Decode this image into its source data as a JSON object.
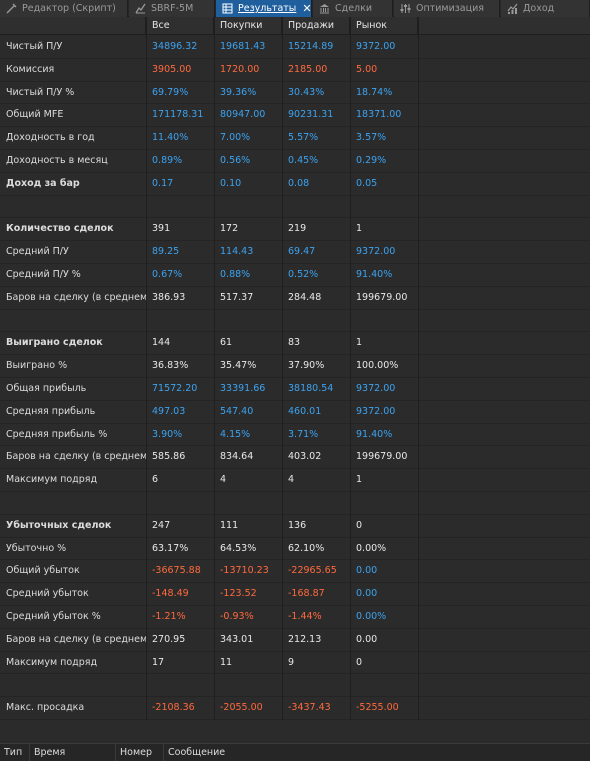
{
  "tabs": [
    {
      "label": "Редактор (Скрипт)",
      "icon": "code-icon",
      "active": false
    },
    {
      "label": "SBRF-5M",
      "icon": "chart-icon",
      "active": false
    },
    {
      "label": "Результаты",
      "icon": "table-icon",
      "active": true
    },
    {
      "label": "Сделки",
      "icon": "bank-icon",
      "active": false
    },
    {
      "label": "Оптимизация",
      "icon": "optimization-icon",
      "active": false
    },
    {
      "label": "Доход",
      "icon": "income-chart-icon",
      "active": false
    }
  ],
  "table": {
    "columns": [
      "",
      "Все",
      "Покупки",
      "Продажи",
      "Рынок"
    ],
    "rows": [
      {
        "label": "Чистый П/У",
        "values": [
          "34896.32",
          "19681.43",
          "15214.89",
          "9372.00"
        ],
        "tone": "blue",
        "bold": false
      },
      {
        "label": "Комиссия",
        "values": [
          "3905.00",
          "1720.00",
          "2185.00",
          "5.00"
        ],
        "tone": "red",
        "bold": false
      },
      {
        "label": "Чистый П/У %",
        "values": [
          "69.79%",
          "39.36%",
          "30.43%",
          "18.74%"
        ],
        "tone": "blue",
        "bold": false
      },
      {
        "label": "Общий MFE",
        "values": [
          "171178.31",
          "80947.00",
          "90231.31",
          "18371.00"
        ],
        "tone": "blue",
        "bold": false
      },
      {
        "label": "Доходность в год",
        "values": [
          "11.40%",
          "7.00%",
          "5.57%",
          "3.57%"
        ],
        "tone": "blue",
        "bold": false
      },
      {
        "label": "Доходность в месяц",
        "values": [
          "0.89%",
          "0.56%",
          "0.45%",
          "0.29%"
        ],
        "tone": "blue",
        "bold": false
      },
      {
        "label": "Доход за бар",
        "values": [
          "0.17",
          "0.10",
          "0.08",
          "0.05"
        ],
        "tone": "blue",
        "bold": true
      },
      {
        "label": "",
        "values": [
          "",
          "",
          "",
          ""
        ],
        "tone": "white",
        "bold": false
      },
      {
        "label": "Количество сделок",
        "values": [
          "391",
          "172",
          "219",
          "1"
        ],
        "tone": "white",
        "bold": true
      },
      {
        "label": "Средний П/У",
        "values": [
          "89.25",
          "114.43",
          "69.47",
          "9372.00"
        ],
        "tone": "blue",
        "bold": false
      },
      {
        "label": "Средний П/У %",
        "values": [
          "0.67%",
          "0.88%",
          "0.52%",
          "91.40%"
        ],
        "tone": "blue",
        "bold": false
      },
      {
        "label": "Баров на сделку (в среднем)",
        "values": [
          "386.93",
          "517.37",
          "284.48",
          "199679.00"
        ],
        "tone": "white",
        "bold": false
      },
      {
        "label": "",
        "values": [
          "",
          "",
          "",
          ""
        ],
        "tone": "white",
        "bold": false
      },
      {
        "label": "Выиграно сделок",
        "values": [
          "144",
          "61",
          "83",
          "1"
        ],
        "tone": "white",
        "bold": true
      },
      {
        "label": "Выиграно %",
        "values": [
          "36.83%",
          "35.47%",
          "37.90%",
          "100.00%"
        ],
        "tone": "white",
        "bold": false
      },
      {
        "label": "Общая прибыль",
        "values": [
          "71572.20",
          "33391.66",
          "38180.54",
          "9372.00"
        ],
        "tone": "blue",
        "bold": false
      },
      {
        "label": "Средняя прибыль",
        "values": [
          "497.03",
          "547.40",
          "460.01",
          "9372.00"
        ],
        "tone": "blue",
        "bold": false
      },
      {
        "label": "Средняя прибыль %",
        "values": [
          "3.90%",
          "4.15%",
          "3.71%",
          "91.40%"
        ],
        "tone": "blue",
        "bold": false
      },
      {
        "label": "Баров на сделку (в среднем)",
        "values": [
          "585.86",
          "834.64",
          "403.02",
          "199679.00"
        ],
        "tone": "white",
        "bold": false
      },
      {
        "label": "Максимум подряд",
        "values": [
          "6",
          "4",
          "4",
          "1"
        ],
        "tone": "white",
        "bold": false
      },
      {
        "label": "",
        "values": [
          "",
          "",
          "",
          ""
        ],
        "tone": "white",
        "bold": false
      },
      {
        "label": "Убыточных сделок",
        "values": [
          "247",
          "111",
          "136",
          "0"
        ],
        "tone": "white",
        "bold": true
      },
      {
        "label": "Убыточно %",
        "values": [
          "63.17%",
          "64.53%",
          "62.10%",
          "0.00%"
        ],
        "tone": "white",
        "bold": false
      },
      {
        "label": "Общий убыток",
        "values": [
          "-36675.88",
          "-13710.23",
          "-22965.65",
          "0.00"
        ],
        "tone": "red",
        "bold": false,
        "last_tone": "blue"
      },
      {
        "label": "Средний убыток",
        "values": [
          "-148.49",
          "-123.52",
          "-168.87",
          "0.00"
        ],
        "tone": "red",
        "bold": false,
        "last_tone": "blue"
      },
      {
        "label": "Средний убыток %",
        "values": [
          "-1.21%",
          "-0.93%",
          "-1.44%",
          "0.00%"
        ],
        "tone": "red",
        "bold": false,
        "last_tone": "blue"
      },
      {
        "label": "Баров на сделку (в среднем)",
        "values": [
          "270.95",
          "343.01",
          "212.13",
          "0.00"
        ],
        "tone": "white",
        "bold": false
      },
      {
        "label": "Максимум подряд",
        "values": [
          "17",
          "11",
          "9",
          "0"
        ],
        "tone": "white",
        "bold": false
      },
      {
        "label": "",
        "values": [
          "",
          "",
          "",
          ""
        ],
        "tone": "white",
        "bold": false
      },
      {
        "label": "Макс. просадка",
        "values": [
          "-2108.36",
          "-2055.00",
          "-3437.43",
          "-5255.00"
        ],
        "tone": "red",
        "bold": false
      }
    ]
  },
  "log_header": {
    "columns": [
      "Тип",
      "Время",
      "Номер",
      "Сообщение"
    ]
  },
  "colors": {
    "positive": "#3ca3f0",
    "negative": "#ff6a3d",
    "active_tab": "#1f5f9e"
  }
}
